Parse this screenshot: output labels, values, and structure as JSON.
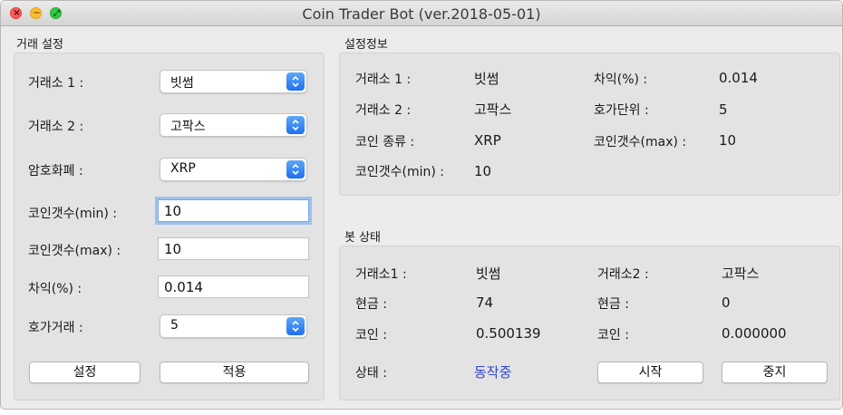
{
  "window": {
    "title": "Coin Trader Bot (ver.2018-05-01)"
  },
  "settings_group": {
    "title": "거래 설정",
    "exchange1": {
      "label": "거래소 1 :",
      "value": "빗썸"
    },
    "exchange2": {
      "label": "거래소 2 :",
      "value": "고팍스"
    },
    "currency": {
      "label": "암호화폐 :",
      "value": "XRP"
    },
    "coin_min": {
      "label": "코인갯수(min) :",
      "value": "10"
    },
    "coin_max": {
      "label": "코인갯수(max) :",
      "value": "10"
    },
    "diff": {
      "label": "차익(%) :",
      "value": "0.014"
    },
    "order_book": {
      "label": "호가거래 :",
      "value": "5"
    },
    "set_button": "설정",
    "apply_button": "적용"
  },
  "info_group": {
    "title": "설정정보",
    "exchange1_label": "거래소 1 :",
    "exchange1_value": "빗썸",
    "exchange2_label": "거래소 2 :",
    "exchange2_value": "고팍스",
    "coin_type_label": "코인 종류 :",
    "coin_type_value": "XRP",
    "coin_min_label": "코인갯수(min) :",
    "coin_min_value": "10",
    "diff_label": "차익(%) :",
    "diff_value": "0.014",
    "tick_label": "호가단위 :",
    "tick_value": "5",
    "coin_max_label": "코인갯수(max) :",
    "coin_max_value": "10"
  },
  "bot_group": {
    "title": "봇 상태",
    "exchange1_label": "거래소1 :",
    "exchange1_value": "빗썸",
    "exchange2_label": "거래소2 :",
    "exchange2_value": "고팍스",
    "cash1_label": "현금 :",
    "cash1_value": "74",
    "cash2_label": "현금 :",
    "cash2_value": "0",
    "coin1_label": "코인 :",
    "coin1_value": "0.500139",
    "coin2_label": "코인 :",
    "coin2_value": "0.000000",
    "state_label": "상태 :",
    "state_value": "동작중",
    "start_button": "시작",
    "stop_button": "중지"
  },
  "colors": {
    "status_running": "#2f45d3",
    "select_arrow": "#1f6ff0"
  }
}
